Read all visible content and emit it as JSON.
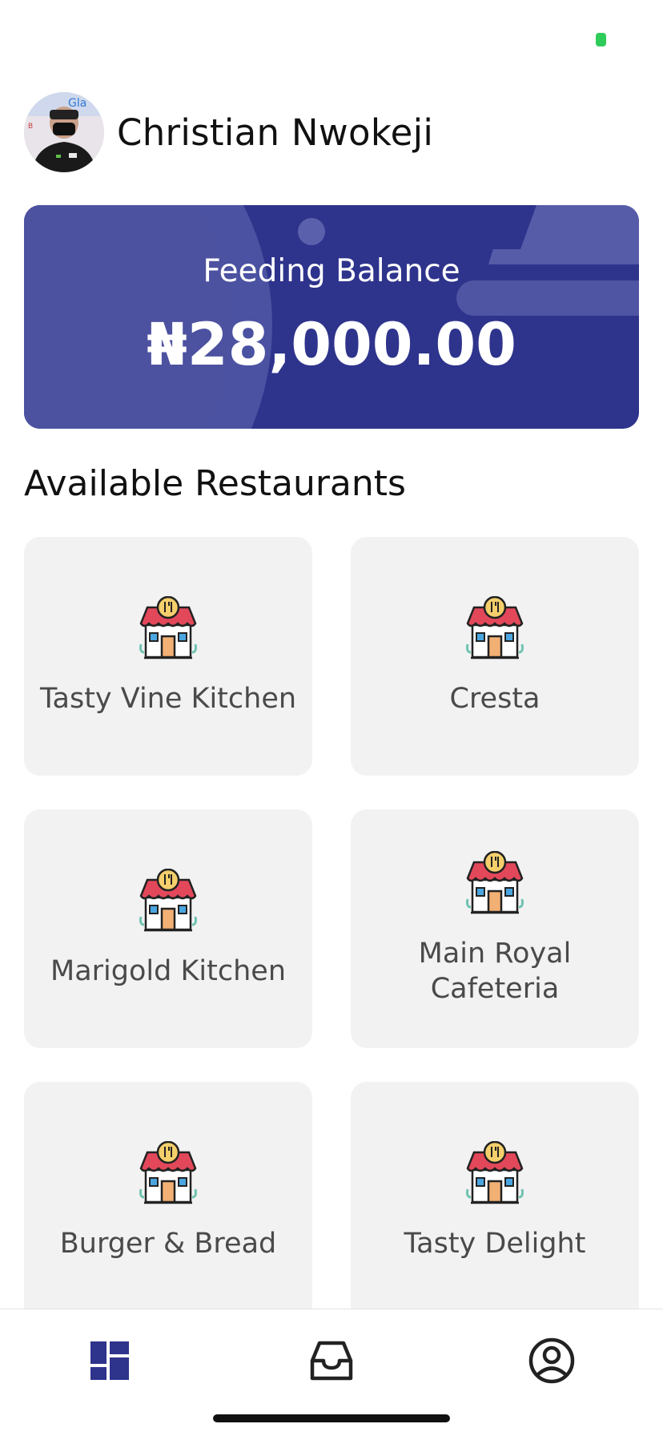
{
  "profile": {
    "name": "Christian Nwokeji"
  },
  "balance": {
    "label": "Feeding Balance",
    "amount": "₦28,000.00"
  },
  "section": {
    "title": "Available Restaurants"
  },
  "restaurants": [
    {
      "name": "Tasty Vine Kitchen",
      "icon": "restaurant-icon"
    },
    {
      "name": "Cresta",
      "icon": "restaurant-icon"
    },
    {
      "name": "Marigold Kitchen",
      "icon": "restaurant-icon"
    },
    {
      "name": "Main Royal Cafeteria",
      "icon": "restaurant-icon"
    },
    {
      "name": "Burger & Bread",
      "icon": "restaurant-icon"
    },
    {
      "name": "Tasty Delight",
      "icon": "restaurant-icon"
    }
  ],
  "nav": {
    "items": [
      {
        "icon": "dashboard-icon",
        "active": true
      },
      {
        "icon": "inbox-icon",
        "active": false
      },
      {
        "icon": "account-icon",
        "active": false
      }
    ]
  },
  "colors": {
    "primary": "#2e338c",
    "card_background": "#f2f2f2",
    "status": "#2ecc58"
  }
}
